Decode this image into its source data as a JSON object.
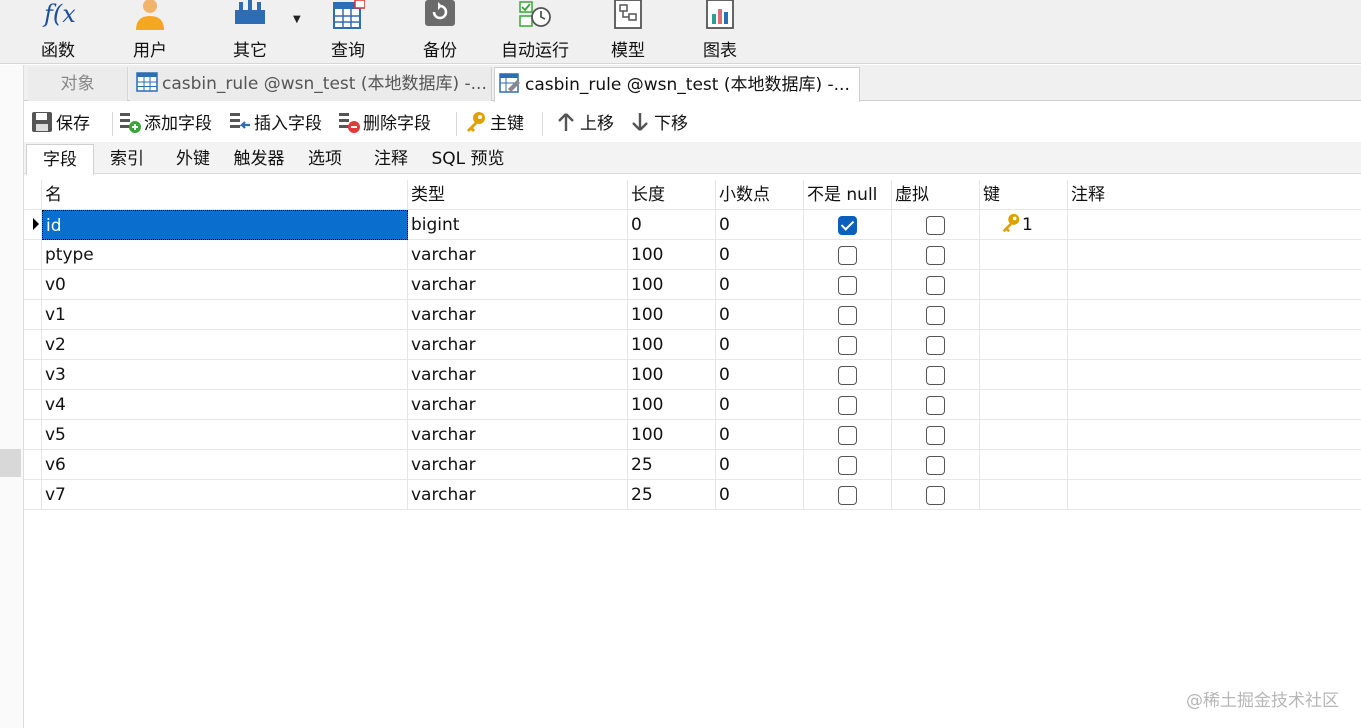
{
  "ribbon": {
    "buttons": [
      {
        "label": "函数",
        "icon": "function-icon"
      },
      {
        "label": "用户",
        "icon": "user-icon"
      },
      {
        "label": "其它",
        "icon": "other-tools-icon"
      },
      {
        "label": "查询",
        "icon": "query-icon"
      },
      {
        "label": "备份",
        "icon": "backup-icon"
      },
      {
        "label": "自动运行",
        "icon": "schedule-icon"
      },
      {
        "label": "模型",
        "icon": "model-icon"
      },
      {
        "label": "图表",
        "icon": "chart-icon"
      }
    ]
  },
  "doc_tabs": {
    "objects": "对象",
    "tab1": "casbin_rule @wsn_test (本地数据库) -...",
    "tab2": "casbin_rule @wsn_test (本地数据库) -..."
  },
  "toolbar": {
    "save": "保存",
    "add_field": "添加字段",
    "insert_field": "插入字段",
    "delete_field": "删除字段",
    "primary_key": "主键",
    "move_up": "上移",
    "move_down": "下移"
  },
  "subtabs": [
    "字段",
    "索引",
    "外键",
    "触发器",
    "选项",
    "注释",
    "SQL 预览"
  ],
  "grid": {
    "headers": {
      "name": "名",
      "type": "类型",
      "length": "长度",
      "decimals": "小数点",
      "not_null": "不是 null",
      "virtual": "虚拟",
      "key": "键",
      "comment": "注释"
    },
    "rows": [
      {
        "name": "id",
        "type": "bigint",
        "length": "0",
        "decimals": "0",
        "not_null": true,
        "virtual": false,
        "key": "1"
      },
      {
        "name": "ptype",
        "type": "varchar",
        "length": "100",
        "decimals": "0",
        "not_null": false,
        "virtual": false,
        "key": ""
      },
      {
        "name": "v0",
        "type": "varchar",
        "length": "100",
        "decimals": "0",
        "not_null": false,
        "virtual": false,
        "key": ""
      },
      {
        "name": "v1",
        "type": "varchar",
        "length": "100",
        "decimals": "0",
        "not_null": false,
        "virtual": false,
        "key": ""
      },
      {
        "name": "v2",
        "type": "varchar",
        "length": "100",
        "decimals": "0",
        "not_null": false,
        "virtual": false,
        "key": ""
      },
      {
        "name": "v3",
        "type": "varchar",
        "length": "100",
        "decimals": "0",
        "not_null": false,
        "virtual": false,
        "key": ""
      },
      {
        "name": "v4",
        "type": "varchar",
        "length": "100",
        "decimals": "0",
        "not_null": false,
        "virtual": false,
        "key": ""
      },
      {
        "name": "v5",
        "type": "varchar",
        "length": "100",
        "decimals": "0",
        "not_null": false,
        "virtual": false,
        "key": ""
      },
      {
        "name": "v6",
        "type": "varchar",
        "length": "25",
        "decimals": "0",
        "not_null": false,
        "virtual": false,
        "key": ""
      },
      {
        "name": "v7",
        "type": "varchar",
        "length": "25",
        "decimals": "0",
        "not_null": false,
        "virtual": false,
        "key": ""
      }
    ]
  },
  "watermark": "@稀土掘金技术社区",
  "colors": {
    "selection": "#0a6ecf",
    "checkbox_checked": "#0b5fbd",
    "key_gold": "#e0a100"
  }
}
